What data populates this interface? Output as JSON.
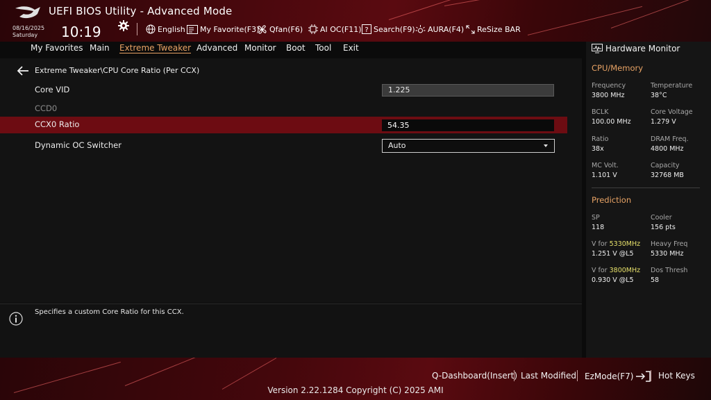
{
  "header": {
    "title": "UEFI BIOS Utility - Advanced Mode",
    "date": "08/16/2025",
    "day": "Saturday",
    "time": "10:19",
    "tools": {
      "language": "English",
      "my_favorite": "My Favorite(F3)",
      "qfan": "Qfan(F6)",
      "ai_oc": "AI OC(F11)",
      "search": "Search(F9)",
      "aura": "AURA(F4)",
      "resize_bar": "ReSize BAR"
    },
    "icons": [
      "rog-logo-icon",
      "gear-icon",
      "globe-icon",
      "favorite-icon",
      "fan-icon",
      "ai-oc-icon",
      "search-help-icon",
      "aura-icon",
      "resize-bar-icon"
    ]
  },
  "menu": {
    "tabs": [
      "My Favorites",
      "Main",
      "Extreme Tweaker",
      "Advanced",
      "Monitor",
      "Boot",
      "Tool",
      "Exit"
    ],
    "active": "Extreme Tweaker"
  },
  "main": {
    "breadcrumb": "Extreme Tweaker\\CPU Core Ratio (Per CCX)",
    "core_vid_label": "Core VID",
    "core_vid_value": "1.225",
    "ccd_label": "CCD0",
    "ccx_ratio_label": "CCX0 Ratio",
    "ccx_ratio_value": "54.35",
    "dynamic_oc_label": "Dynamic OC Switcher",
    "dynamic_oc_value": "Auto"
  },
  "help": {
    "text": "Specifies a custom Core Ratio for this CCX."
  },
  "hardware_monitor": {
    "title": "Hardware Monitor",
    "cpu_memory": {
      "heading": "CPU/Memory",
      "frequency_label": "Frequency",
      "frequency_value": "3800 MHz",
      "temperature_label": "Temperature",
      "temperature_value": "38°C",
      "bclk_label": "BCLK",
      "bclk_value": "100.00 MHz",
      "core_voltage_label": "Core Voltage",
      "core_voltage_value": "1.279 V",
      "ratio_label": "Ratio",
      "ratio_value": "38x",
      "dram_freq_label": "DRAM Freq.",
      "dram_freq_value": "4800 MHz",
      "mc_volt_label": "MC Volt.",
      "mc_volt_value": "1.101 V",
      "capacity_label": "Capacity",
      "capacity_value": "32768 MB"
    },
    "prediction": {
      "heading": "Prediction",
      "sp_label": "SP",
      "sp_value": "118",
      "cooler_label": "Cooler",
      "cooler_value": "156 pts",
      "v_for_label_prefix": "V for ",
      "v_for_1_freq": "5330MHz",
      "v_for_1_value": "1.251 V @L5",
      "heavy_freq_label": "Heavy Freq",
      "heavy_freq_value": "5330 MHz",
      "v_for_2_freq": "3800MHz",
      "v_for_2_value": "0.930 V @L5",
      "dos_thresh_label": "Dos Thresh",
      "dos_thresh_value": "58"
    }
  },
  "footer": {
    "q_dashboard": "Q-Dashboard(Insert)",
    "last_modified": "Last Modified",
    "ezmode": "EzMode(F7)",
    "hot_keys": "Hot Keys",
    "version": "Version 2.22.1284 Copyright (C) 2025 AMI"
  },
  "colors": {
    "accent": "#e8a365",
    "selected_row": "#6d0c12",
    "header_red": "#5a0a10",
    "highlight_freq": "#e6e06a"
  }
}
